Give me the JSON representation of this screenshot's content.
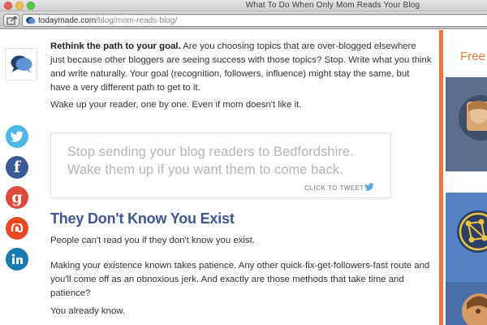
{
  "browser": {
    "window_title": "What To Do When Only Mom Reads Your Blog",
    "url_host": "todaymade.com",
    "url_path": "/blog/mom-reads-blog/"
  },
  "article": {
    "p1_bold": "Rethink the path to your goal.",
    "p1_rest": " Are you choosing topics that are over-blogged elsewhere just because other bloggers are seeing success with those topics? Stop. Write what you think and write naturally. Your goal (recognition, followers, influence) might stay the same, but have a very different path to get to it.",
    "p2": "Wake up your reader, one by one. Even if mom doesn't like it.",
    "tweet_quote": "Stop sending your blog readers to Bedfordshire. Wake them up if you want them to come back.",
    "click_to_tweet": "CLICK TO TWEET",
    "heading": "They Don't Know You Exist",
    "p3": "People can't read you if they don't know you exist.",
    "p4": "Making your existence known takes patience. Any other quick-fix-get-followers-fast route and you'll come off as an obnoxious jerk. And exactly are those methods that take time and patience?",
    "p5": "You already know."
  },
  "social_icons": [
    {
      "name": "twitter-icon",
      "color": "#4cb6e8"
    },
    {
      "name": "facebook-icon",
      "color": "#3b5a9a"
    },
    {
      "name": "google-plus-icon",
      "color": "#dd4b3f"
    },
    {
      "name": "stumbleupon-icon",
      "color": "#eb4924"
    },
    {
      "name": "linkedin-icon",
      "color": "#1a7ab3"
    }
  ],
  "sidebar": {
    "heading": "Free",
    "accent_color": "#f3753d"
  },
  "colors": {
    "heading": "#3f5693",
    "tweet_text": "#b5b5b5"
  }
}
